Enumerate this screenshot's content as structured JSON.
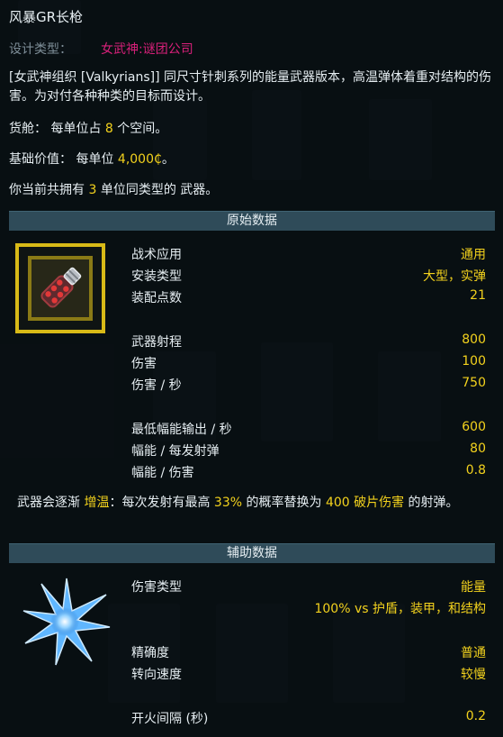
{
  "title": "风暴GR长枪",
  "design_type": {
    "label": "设计类型：",
    "value": "女武神:谜团公司"
  },
  "description": "[女武神组织 [Valkyrians]] 同尺寸针刺系列的能量武器版本，高温弹体着重对结构的伤害。为对付各种种类的目标而设计。",
  "cargo": {
    "prefix": "货舱：  每单位占 ",
    "amount": "8",
    "suffix": " 个空间。"
  },
  "base_value": {
    "prefix": "基础价值：  每单位 ",
    "amount": "4,000₵",
    "suffix": "。"
  },
  "owned": {
    "prefix": "你当前共拥有 ",
    "amount": "3",
    "suffix": " 单位同类型的 武器。"
  },
  "primary": {
    "header": "原始数据",
    "icon": "energy-weapon-icon",
    "stats": [
      {
        "label": "战术应用",
        "value": "通用"
      },
      {
        "label": "安装类型",
        "value": "大型，实弹"
      },
      {
        "label": "装配点数",
        "value": "21"
      },
      {
        "label": "武器射程",
        "value": "800"
      },
      {
        "label": "伤害",
        "value": "100"
      },
      {
        "label": "伤害 / 秒",
        "value": "750"
      },
      {
        "label": "最低幅能输出 / 秒",
        "value": "600"
      },
      {
        "label": "幅能 / 每发射弹",
        "value": "80"
      },
      {
        "label": "幅能 / 伤害",
        "value": "0.8"
      }
    ],
    "note": {
      "p1": "武器会逐渐 ",
      "h1": "增温",
      "p2": "：每次发射有最高 ",
      "h2": "33%",
      "p3": " 的概率替换为 ",
      "h3": "400 破片伤害",
      "p4": " 的射弹。"
    }
  },
  "secondary": {
    "header": "辅助数据",
    "icon": "energy-burst-icon",
    "stats": [
      {
        "label": "伤害类型",
        "value": "能量"
      },
      {
        "label": "",
        "value": "100% vs 护盾，装甲，和结构"
      },
      {
        "label": "精确度",
        "value": "普通"
      },
      {
        "label": "转向速度",
        "value": "较慢"
      },
      {
        "label": "开火间隔 (秒)",
        "value": "0.2"
      }
    ]
  },
  "colors": {
    "highlight": "#f3d21d",
    "manufacturer": "#d8207a",
    "section_bar": "#2f4b59",
    "frame": "#d8ba17"
  }
}
